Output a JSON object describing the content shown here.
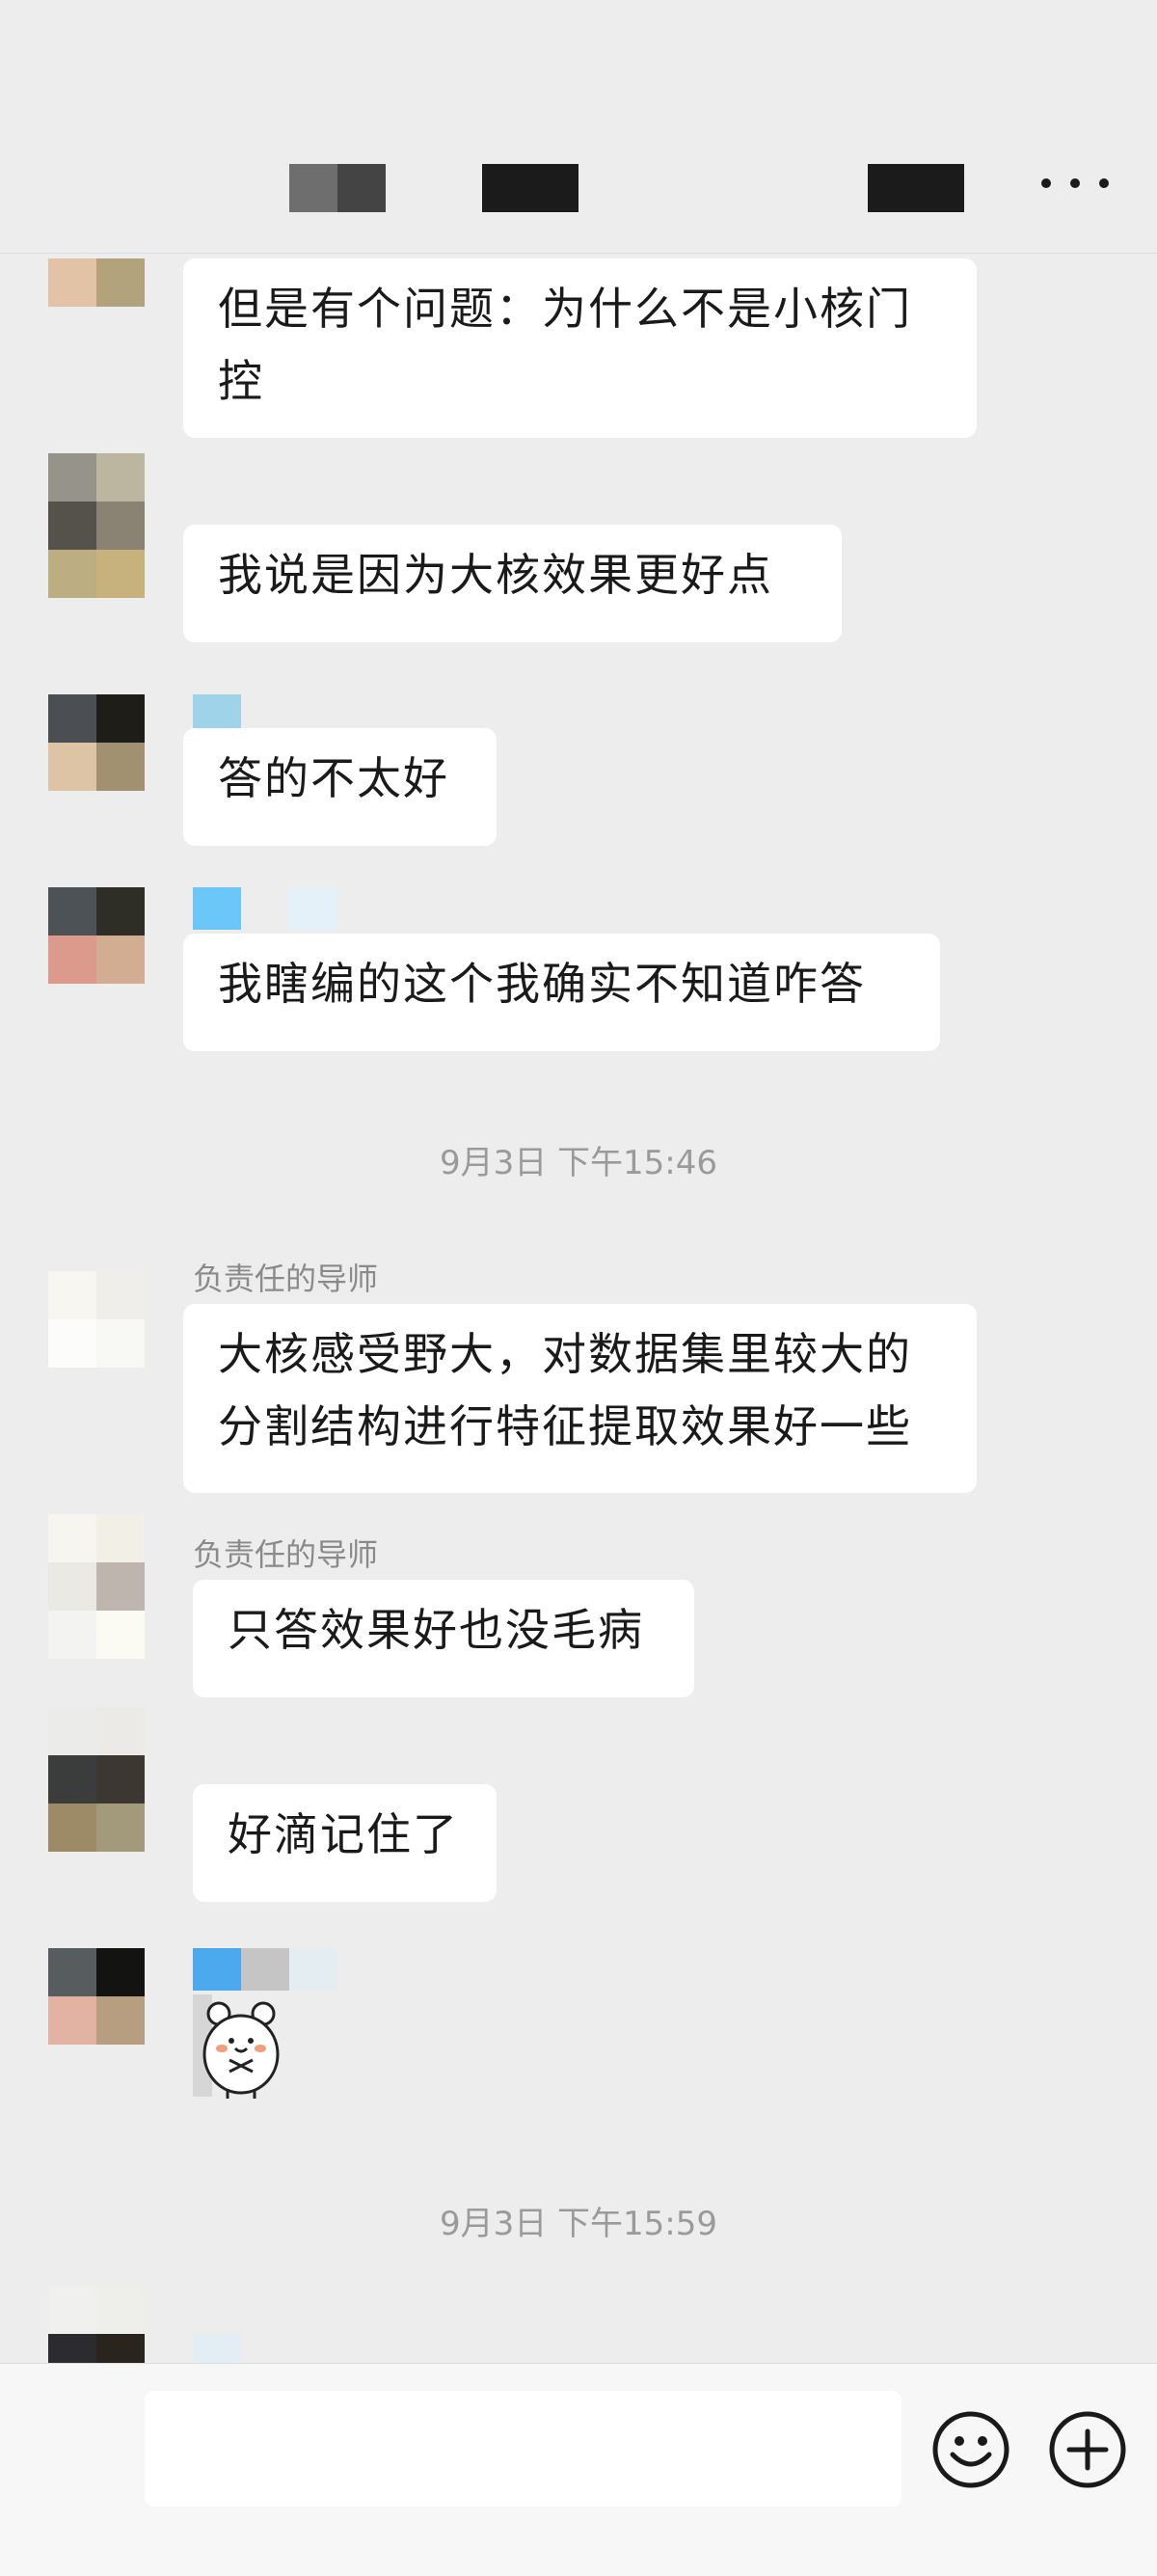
{
  "chat": {
    "messages": [
      {
        "text": "但是有个问题：为什么不是小核门\n控"
      },
      {
        "text": "我说是因为大核效果更好点"
      },
      {
        "text": "答的不太好"
      },
      {
        "text": "我瞎编的这个我确实不知道咋答"
      },
      {
        "sender": "负责任的导师",
        "text": "大核感受野大，对数据集里较大的\n分割结构进行特征提取效果好一些"
      },
      {
        "sender": "负责任的导师",
        "text": "只答效果好也没毛病"
      },
      {
        "text": "好滴记住了"
      }
    ],
    "timestamps": [
      "9月3日 下午15:46",
      "9月3日 下午15:59"
    ]
  },
  "icons": {
    "more": "more-dots-icon",
    "emoji": "emoji-smile-icon",
    "add": "plus-circle-icon",
    "sticker": "bear-sticker"
  },
  "colors": {
    "background": "#ededed",
    "bubble": "#ffffff",
    "timestamp_text": "#9a9a9a",
    "input_bar": "#f7f7f7"
  }
}
